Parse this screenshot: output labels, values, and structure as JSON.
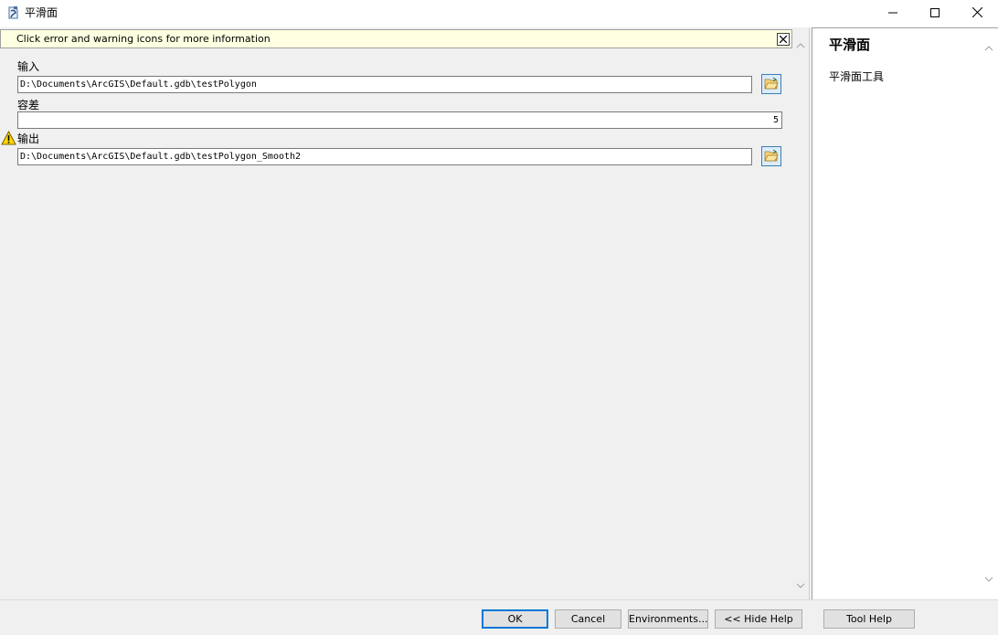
{
  "window": {
    "title": "平滑面",
    "app_icon": "arctoolbox-tool-icon",
    "controls": [
      "minimize-icon",
      "maximize-icon",
      "close-icon"
    ]
  },
  "infobar": {
    "message": "Click error and warning icons for more information",
    "close_icon": "close-icon"
  },
  "params": {
    "input": {
      "label": "输入",
      "value": "D:\\Documents\\ArcGIS\\Default.gdb\\testPolygon"
    },
    "tolerance": {
      "label": "容差",
      "value": "5"
    },
    "output": {
      "label": "输出",
      "value": "D:\\Documents\\ArcGIS\\Default.gdb\\testPolygon_Smooth2",
      "status_icon": "warning-icon"
    }
  },
  "help": {
    "title": "平滑面",
    "description": "平滑面工具"
  },
  "buttons": {
    "ok": "OK",
    "cancel": "Cancel",
    "environments": "Environments...",
    "hide_help": "<< Hide Help",
    "tool_help": "Tool Help"
  },
  "colors": {
    "infobar_bg": "#ffffe1",
    "accent": "#0078d7",
    "warning": "#ffd800"
  }
}
